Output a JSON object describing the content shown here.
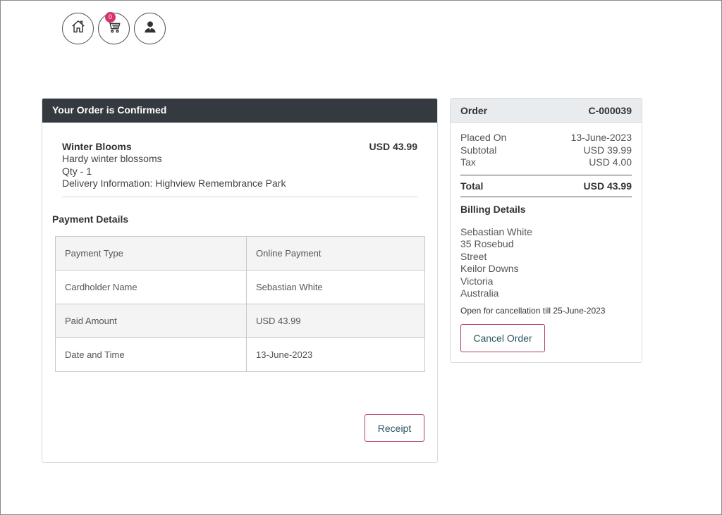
{
  "nav": {
    "cart_count": "0",
    "icons": [
      "home-icon",
      "cart-icon",
      "user-icon"
    ]
  },
  "confirmation": {
    "header": "Your Order is Confirmed",
    "item": {
      "name": "Winter Blooms",
      "description": "Hardy winter blossoms",
      "qty": "Qty - 1",
      "delivery": "Delivery Information: Highview Remembrance Park",
      "price": "USD 43.99"
    },
    "payment_title": "Payment Details",
    "payment_rows": [
      {
        "label": "Payment Type",
        "value": "Online Payment"
      },
      {
        "label": "Cardholder Name",
        "value": "Sebastian White"
      },
      {
        "label": "Paid Amount",
        "value": "USD 43.99"
      },
      {
        "label": "Date and Time",
        "value": "13-June-2023"
      }
    ],
    "receipt_label": "Receipt"
  },
  "order": {
    "header_label": "Order",
    "order_id": "C-000039",
    "placed_on_label": "Placed On",
    "placed_on_value": "13-June-2023",
    "subtotal_label": "Subtotal",
    "subtotal_value": "USD 39.99",
    "tax_label": "Tax",
    "tax_value": "USD 4.00",
    "total_label": "Total",
    "total_value": "USD 43.99",
    "billing_title": "Billing Details",
    "billing_address": [
      "Sebastian White",
      "35 Rosebud",
      "Street",
      "Keilor Downs",
      "Victoria",
      "Australia"
    ],
    "cancel_note": "Open for cancellation till 25-June-2023",
    "cancel_label": "Cancel Order"
  },
  "colors": {
    "header_dark": "#343a40",
    "accent": "#b33a63",
    "badge": "#d6336c"
  }
}
